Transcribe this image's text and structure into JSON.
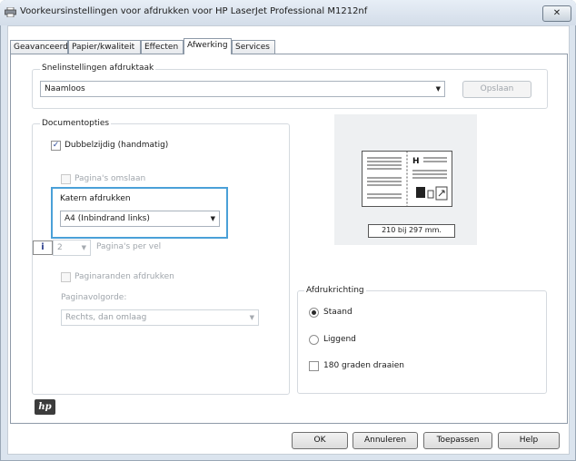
{
  "window": {
    "title": "Voorkeursinstellingen voor afdrukken voor HP LaserJet Professional M1212nf",
    "close_label": "✕"
  },
  "tabs": [
    {
      "label": "Geavanceerd"
    },
    {
      "label": "Papier/kwaliteit"
    },
    {
      "label": "Effecten"
    },
    {
      "label": "Afwerking"
    },
    {
      "label": "Services"
    }
  ],
  "quick_set": {
    "group_label": "Snelinstellingen afdruktaak",
    "value": "Naamloos",
    "save_label": "Opslaan"
  },
  "document_options": {
    "group_label": "Documentopties",
    "duplex_label": "Dubbelzijdig (handmatig)",
    "duplex_checked": true,
    "flip_pages_label": "Pagina's omslaan",
    "booklet_label": "Katern afdrukken",
    "booklet_value": "A4 (Inbindrand links)",
    "pages_per_sheet_value": "2",
    "pages_per_sheet_label": "Pagina's per vel",
    "page_borders_label": "Paginaranden afdrukken",
    "page_order_label": "Paginavolgorde:",
    "page_order_value": "Rechts, dan omlaag"
  },
  "preview": {
    "size_label": "210 bij 297 mm."
  },
  "orientation": {
    "group_label": "Afdrukrichting",
    "portrait_label": "Staand",
    "landscape_label": "Liggend",
    "rotate_label": "180 graden draaien",
    "selected": "Staand"
  },
  "footer": {
    "logo_text": "hp",
    "ok_label": "OK",
    "cancel_label": "Annuleren",
    "apply_label": "Toepassen",
    "help_label": "Help"
  },
  "colors": {
    "highlight": "#4aa0d8",
    "disabled_text": "#a0a6ac"
  }
}
